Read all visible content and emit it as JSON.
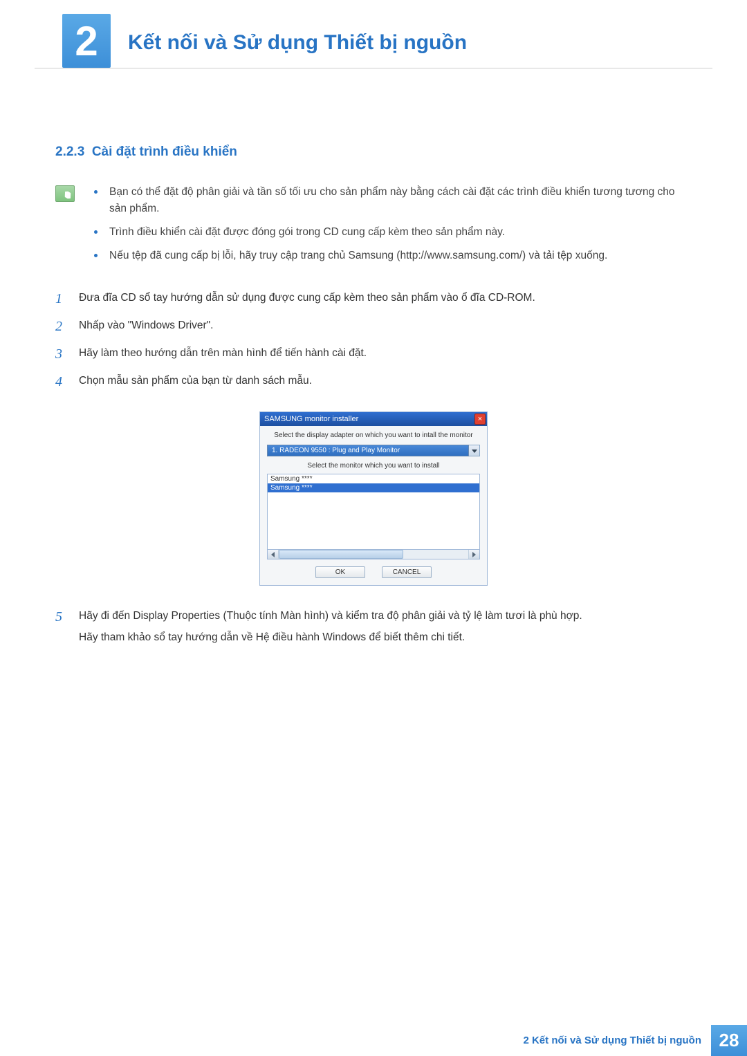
{
  "chapter": {
    "number": "2",
    "title": "Kết nối và Sử dụng Thiết bị nguồn"
  },
  "section": {
    "number": "2.2.3",
    "title": "Cài đặt trình điều khiển"
  },
  "notes": [
    "Bạn có thể đặt độ phân giải và tần số tối ưu cho sản phẩm này bằng cách cài đặt các trình điều khiển tương tương cho sản phẩm.",
    "Trình điều khiển cài đặt được đóng gói trong CD cung cấp kèm theo sản phẩm này.",
    "Nếu tệp đã cung cấp bị lỗi, hãy truy cập trang chủ Samsung (http://www.samsung.com/) và tải tệp xuống."
  ],
  "steps": [
    {
      "n": "1",
      "text": "Đưa đĩa CD sổ tay hướng dẫn sử dụng được cung cấp kèm theo sản phẩm vào ổ đĩa CD-ROM."
    },
    {
      "n": "2",
      "text": "Nhấp vào \"Windows Driver\"."
    },
    {
      "n": "3",
      "text": "Hãy làm theo hướng dẫn trên màn hình để tiến hành cài đặt."
    },
    {
      "n": "4",
      "text": "Chọn mẫu sản phẩm của bạn từ danh sách mẫu."
    },
    {
      "n": "5",
      "text": "Hãy đi đến Display Properties (Thuộc tính Màn hình) và kiểm tra độ phân giải và tỷ lệ làm tươi là phù hợp.",
      "extra": "Hãy tham khảo sổ tay hướng dẫn về Hệ điều hành Windows để biết thêm chi tiết."
    }
  ],
  "installer": {
    "title": "SAMSUNG monitor installer",
    "label1": "Select the display adapter on which you want to intall the monitor",
    "adapter": "1. RADEON 9550 : Plug and Play Monitor",
    "label2": "Select the monitor which you want to install",
    "listItems": [
      "Samsung ****",
      "Samsung ****"
    ],
    "selectedIndex": 1,
    "ok": "OK",
    "cancel": "CANCEL"
  },
  "footer": {
    "label": "2 Kết nối và Sử dụng Thiết bị nguồn",
    "page": "28"
  }
}
